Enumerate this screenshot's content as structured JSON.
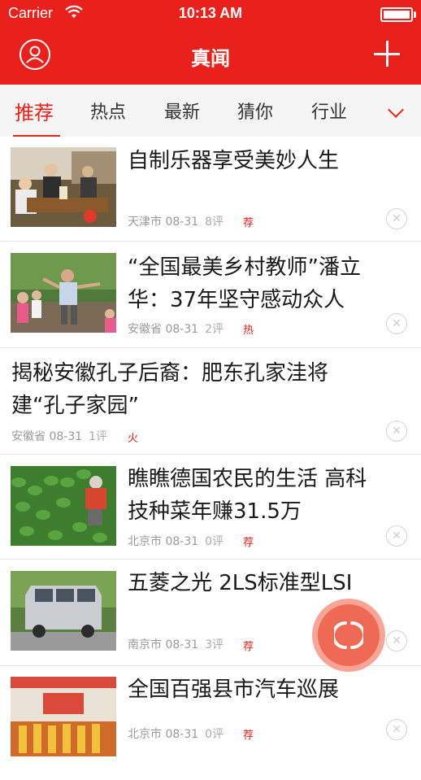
{
  "status": {
    "carrier": "Carrier",
    "time": "10:13 AM"
  },
  "nav": {
    "title": "真闻"
  },
  "tabs": [
    {
      "label": "推荐",
      "active": true
    },
    {
      "label": "热点"
    },
    {
      "label": "最新"
    },
    {
      "label": "猜你"
    },
    {
      "label": "行业"
    }
  ],
  "articles": [
    {
      "title_line1": "自制乐器享受美妙人生",
      "title_line2": "",
      "location": "天津市 08-31",
      "comments": "8评",
      "tag": "荐"
    },
    {
      "title_line1": "“全国最美乡村教师”潘立",
      "title_line2": "华：37年坚守感动众人",
      "location": "安徽省 08-31",
      "comments": "2评",
      "tag": "热"
    },
    {
      "title_line1": "揭秘安徽孔子后裔：肥东孔家洼将",
      "title_line2": "建“孔子家园”",
      "location": "安徽省 08-31",
      "comments": "1评",
      "tag": "火"
    },
    {
      "title_line1": "瞧瞧德国农民的生活 高科",
      "title_line2": "技种菜年赚31.5万",
      "location": "北京市 08-31",
      "comments": "0评",
      "tag": "荐"
    },
    {
      "title_line1": "五菱之光 2LS标准型LSI",
      "title_line2": "",
      "location": "南京市 08-31",
      "comments": "3评",
      "tag": "荐"
    },
    {
      "title_line1": "全国百强县市汽车巡展",
      "title_line2": "",
      "location": "北京市 08-31",
      "comments": "0评",
      "tag": "荐"
    }
  ],
  "colors": {
    "brand_red": "#e8211c",
    "fab": "#ee6a55"
  }
}
